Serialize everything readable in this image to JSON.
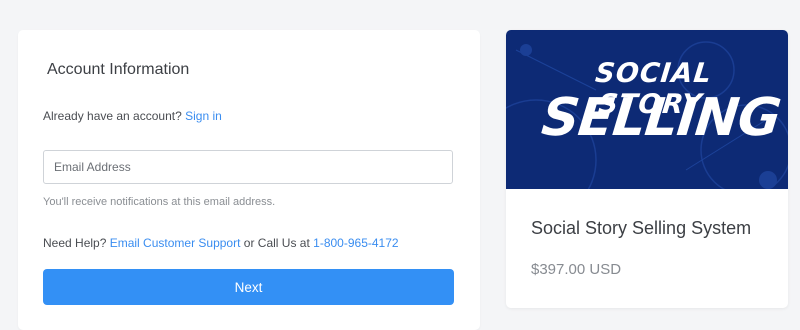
{
  "account": {
    "title": "Account Information",
    "have_account_text": "Already have an account?",
    "sign_in_label": "Sign in",
    "email_placeholder": "Email Address",
    "email_value": "",
    "helper_text": "You'll receive notifications at this email address.",
    "help_prefix": "Need Help?",
    "email_support_label": "Email Customer Support",
    "call_text": "or Call Us at",
    "phone": "1-800-965-4172",
    "next_label": "Next"
  },
  "product": {
    "banner_line_1": "SOCIAL STORY",
    "banner_line_2": "SELLING",
    "name": "Social Story Selling System",
    "price": "$397.00 USD"
  },
  "colors": {
    "accent": "#3390f5",
    "link": "#3a8df0",
    "banner_bg": "#0d2a75",
    "page_bg": "#f4f5f7"
  }
}
